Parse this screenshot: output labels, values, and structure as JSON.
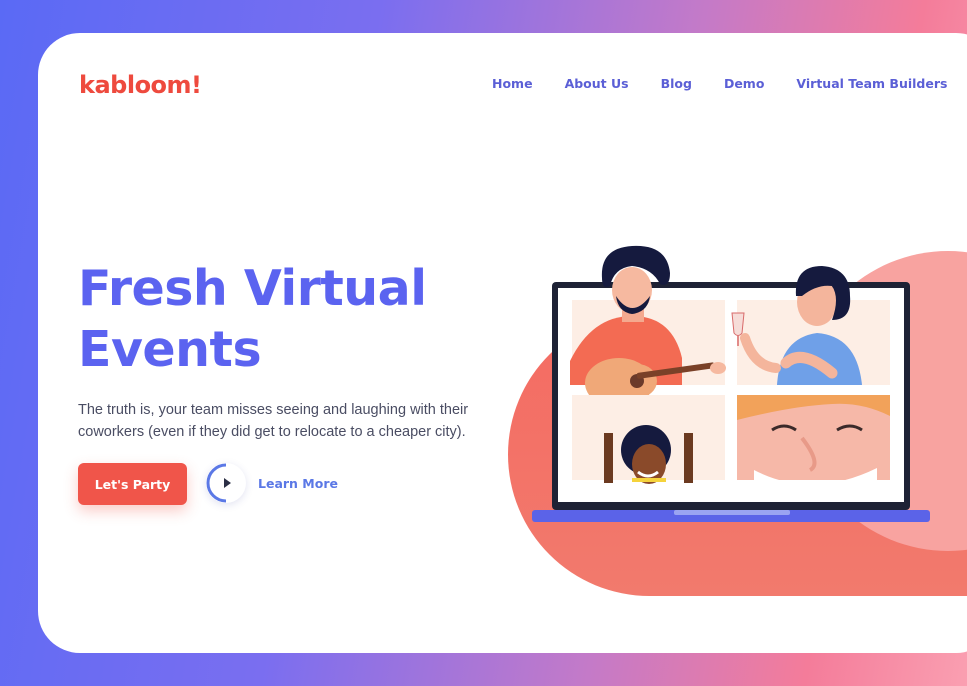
{
  "brand": {
    "logo": "kabloom!"
  },
  "nav": [
    {
      "label": "Home"
    },
    {
      "label": "About Us"
    },
    {
      "label": "Blog"
    },
    {
      "label": "Demo"
    },
    {
      "label": "Virtual Team Builders"
    }
  ],
  "hero": {
    "title": "Fresh Virtual Events",
    "description": "The truth is, your team misses seeing and laughing with their coworkers (even if they did get to relocate to a cheaper city).",
    "cta_label": "Let's Party",
    "learn_more_label": "Learn More"
  },
  "colors": {
    "brand_red": "#ee4a3e",
    "primary_blue": "#5b63f0",
    "nav_blue": "#5b5fd6",
    "cta": "#f0554a"
  }
}
